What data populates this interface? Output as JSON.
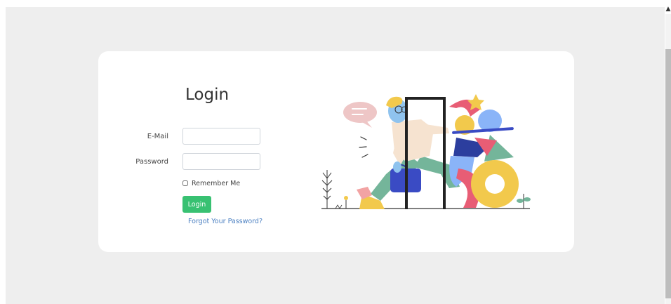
{
  "login": {
    "title": "Login",
    "email_label": "E-Mail",
    "email_value": "",
    "password_label": "Password",
    "password_value": "",
    "remember_label": "Remember Me",
    "remember_checked": false,
    "submit_label": "Login",
    "forgot_link": "Forgot Your Password?"
  },
  "colors": {
    "page_background": "#eeeeee",
    "card_background": "#ffffff",
    "submit_button": "#38c172",
    "link": "#4a7fc1",
    "input_border": "#cfd4da"
  },
  "icons": [
    "speech-bubble-icon",
    "plant-icon",
    "flower-icon",
    "sprout-icon",
    "star-icon"
  ]
}
